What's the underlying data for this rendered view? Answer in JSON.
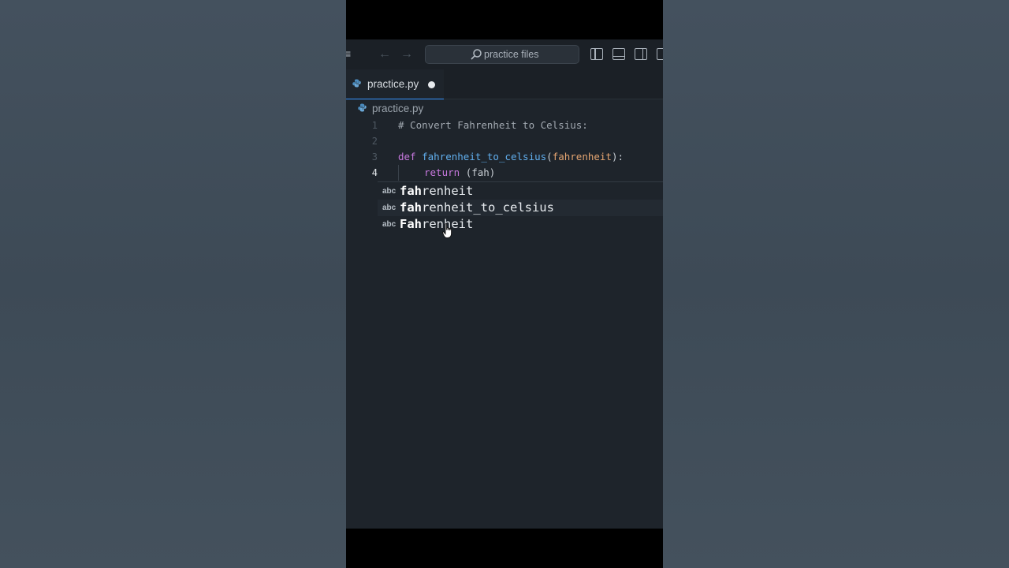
{
  "titlebar": {
    "search_placeholder": "practice files"
  },
  "tabs": [
    {
      "label": "practice.py",
      "modified": true
    }
  ],
  "breadcrumb": {
    "file": "practice.py"
  },
  "code": {
    "lines": [
      {
        "number": "1",
        "text": "# Convert Fahrenheit to Celsius:"
      },
      {
        "number": "2",
        "text": ""
      },
      {
        "number": "3",
        "keyword": "def",
        "function": "fahrenheit_to_celsius",
        "open": "(",
        "param": "fahrenheit",
        "close": "):"
      },
      {
        "number": "4",
        "keyword": "return",
        "typed": "(fah)"
      }
    ]
  },
  "suggestions": [
    {
      "kind": "abc",
      "match": "fah",
      "rest": "renheit"
    },
    {
      "kind": "abc",
      "match": "fah",
      "rest": "renheit_to_celsius"
    },
    {
      "kind": "abc",
      "match": "Fah",
      "rest": "renheit"
    }
  ],
  "colors": {
    "keyword": "#c678dd",
    "function": "#61afef",
    "parameter": "#e5a571",
    "tab_accent": "#3794ff"
  }
}
